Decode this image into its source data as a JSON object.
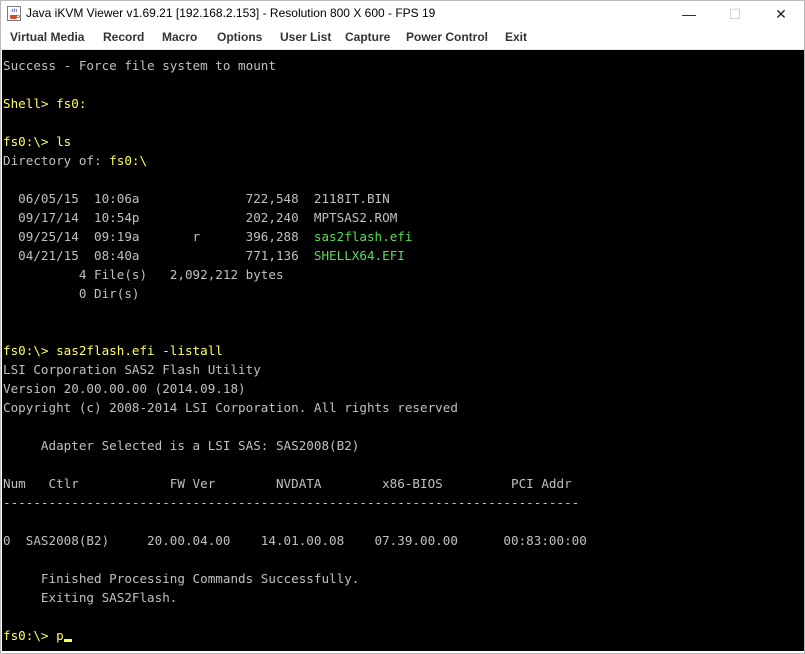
{
  "window": {
    "title": "Java iKVM Viewer v1.69.21 [192.168.2.153]  - Resolution 800 X 600 - FPS 19",
    "minimize_glyph": "—",
    "maximize_glyph": "☐",
    "close_glyph": "✕"
  },
  "menu": {
    "items": [
      "Virtual Media",
      "Record",
      "Macro",
      "Options",
      "User List",
      "Capture",
      "Power Control",
      "Exit"
    ]
  },
  "terminal": {
    "mount_msg": "Success - Force file system to mount",
    "prompt_shell": "Shell> fs0:",
    "prompt_ls": "fs0:\\> ls",
    "dir_label": "Directory of: ",
    "dir_path": "fs0:\\",
    "files": [
      {
        "prefix": "  06/05/15  10:06a              722,548  ",
        "name": "2118IT.BIN"
      },
      {
        "prefix": "  09/17/14  10:54p              202,240  ",
        "name": "MPTSAS2.ROM"
      },
      {
        "prefix": "  09/25/14  09:19a       r      396,288  ",
        "name": "sas2flash.efi"
      },
      {
        "prefix": "  04/21/15  08:40a              771,136  ",
        "name": "SHELLX64.EFI"
      }
    ],
    "files_summary": "          4 File(s)   2,092,212 bytes",
    "dirs_summary": "          0 Dir(s)",
    "prompt_cmd": "fs0:\\> sas2flash.efi -listall",
    "util_name": "LSI Corporation SAS2 Flash Utility",
    "version": "Version 20.00.00.00 (2014.09.18)",
    "copyright": "Copyright (c) 2008-2014 LSI Corporation. All rights reserved",
    "adapter_selected": "     Adapter Selected is a LSI SAS: SAS2008(B2)",
    "table_header": "Num   Ctlr            FW Ver        NVDATA        x86-BIOS         PCI Addr",
    "separator": "----------------------------------------------------------------------------",
    "table_row": "0  SAS2008(B2)     20.00.04.00    14.01.00.08    07.39.00.00      00:83:00:00",
    "finished": "     Finished Processing Commands Successfully.",
    "exiting": "     Exiting SAS2Flash.",
    "final_prompt": "fs0:\\> ",
    "typed": "p"
  },
  "colors": {
    "terminal_bg": "#000000",
    "default_text": "#c0c0c0",
    "prompt_yellow": "#ffff5a",
    "efi_green": "#55dd55"
  }
}
